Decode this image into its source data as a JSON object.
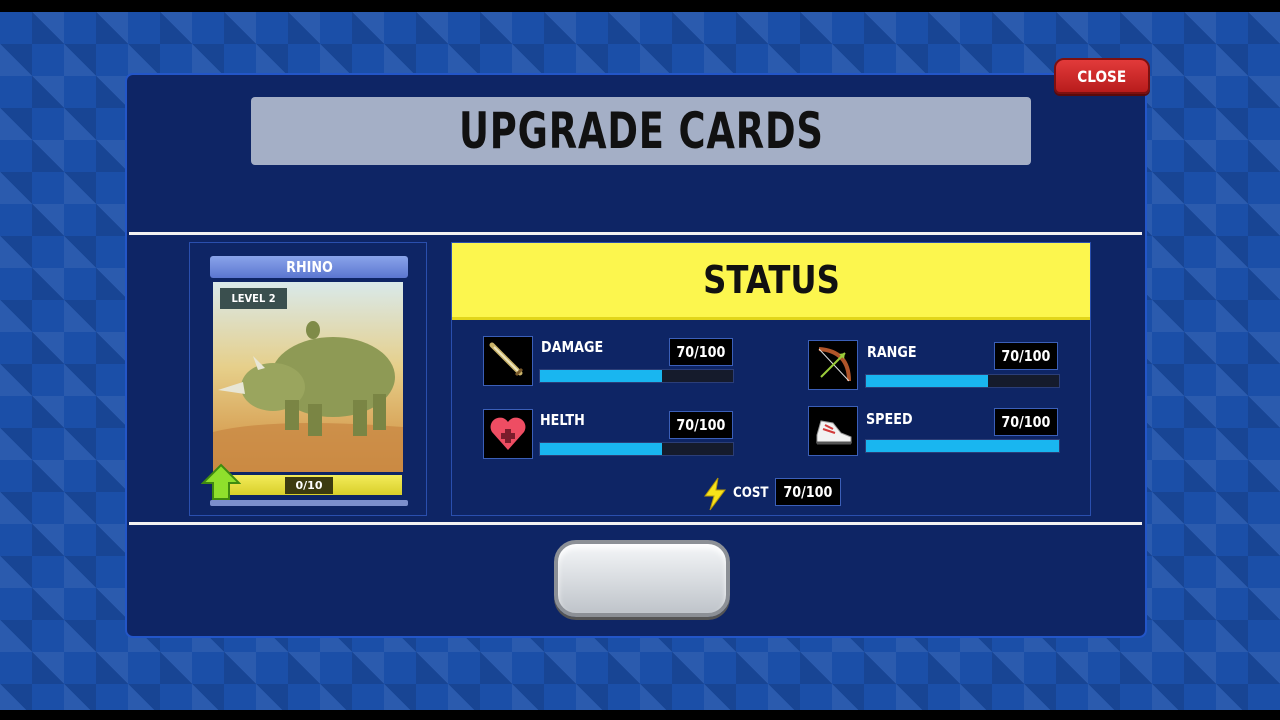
{
  "header": {
    "title": "UPGRADE CARDS",
    "close_label": "CLOSE"
  },
  "card": {
    "name": "RHINO",
    "level": "LEVEL 2",
    "progress": "0/10"
  },
  "status": {
    "title": "STATUS",
    "stats": [
      {
        "label": "DAMAGE",
        "value": "70/100",
        "fill": 0.63,
        "icon": "sword-icon"
      },
      {
        "label": "RANGE",
        "value": "70/100",
        "fill": 0.63,
        "icon": "bow-icon"
      },
      {
        "label": "HELTH",
        "value": "70/100",
        "fill": 0.63,
        "icon": "heart-icon"
      },
      {
        "label": "SPEED",
        "value": "70/100",
        "fill": 1.0,
        "icon": "shoe-icon"
      }
    ],
    "cost_label": "COST",
    "cost_value": "70/100"
  },
  "colors": {
    "accent": "#fcf64e",
    "bar_fill": "#19b6f0",
    "close": "#d42a2a"
  }
}
